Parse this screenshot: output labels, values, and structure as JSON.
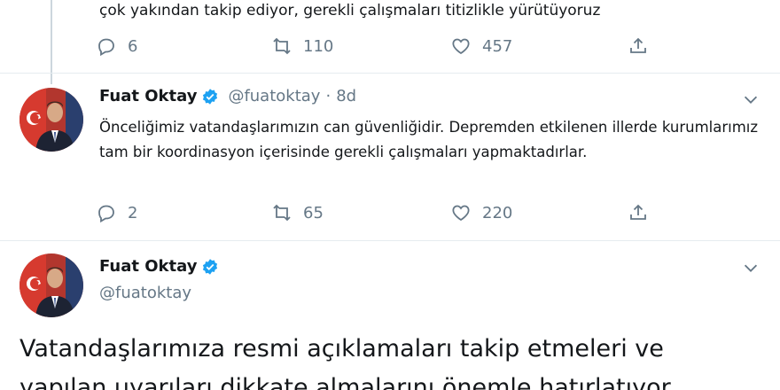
{
  "prev_tweet": {
    "text_tail": "çok yakından takip ediyor, gerekli çalışmaları titizlikle yürütüyoruz",
    "replies": "6",
    "retweets": "110",
    "likes": "457"
  },
  "tweet1": {
    "name": "Fuat Oktay",
    "handle": "@fuatoktay",
    "separator": "·",
    "time": "8d",
    "body": "Önceliğimiz vatandaşlarımızın can güvenliğidir. Depremden etkilenen illerde kurumlarımız tam bir koordinasyon içerisinde gerekli çalışmaları yapmaktadırlar.",
    "replies": "2",
    "retweets": "65",
    "likes": "220"
  },
  "tweet2": {
    "name": "Fuat Oktay",
    "handle": "@fuatoktay",
    "body_line1": "Vatandaşlarımıza resmi açıklamaları takip etmeleri ve",
    "body_line2": "yapılan uyarıları dikkate almalarını önemle hatırlatıyor"
  },
  "colors": {
    "verified": "#1da1f2",
    "muted": "#657786",
    "divider": "#e6ecf0"
  },
  "icons": [
    "reply-icon",
    "retweet-icon",
    "like-icon",
    "share-icon",
    "verified-badge-icon",
    "chevron-down-icon"
  ]
}
